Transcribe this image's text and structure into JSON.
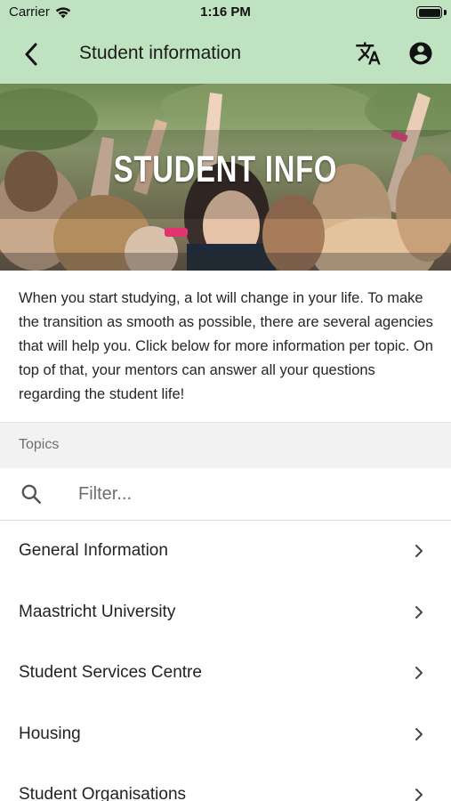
{
  "status_bar": {
    "carrier": "Carrier",
    "time": "1:16 PM",
    "icons": [
      "wifi-icon",
      "battery-icon"
    ]
  },
  "nav": {
    "title": "Student information",
    "back_icon": "chevron-left-icon",
    "translate_icon": "translate-icon",
    "account_icon": "account-circle-icon"
  },
  "hero": {
    "title": "STUDENT INFO"
  },
  "intro": {
    "text": "When you start studying, a lot will change in your life. To make the transition as smooth as possible, there are several agencies that will help you. Click below for more information per topic. On top of that, your mentors can answer all your questions regarding the student life!"
  },
  "topics": {
    "header": "Topics",
    "search_placeholder": "Filter...",
    "search_value": "",
    "items": [
      {
        "label": "General Information"
      },
      {
        "label": "Maastricht University"
      },
      {
        "label": "Student Services Centre"
      },
      {
        "label": "Housing"
      },
      {
        "label": "Student Organisations"
      }
    ]
  },
  "colors": {
    "header_bg": "#bfe3c0",
    "section_bg": "#f2f2f2",
    "text": "#222222"
  }
}
